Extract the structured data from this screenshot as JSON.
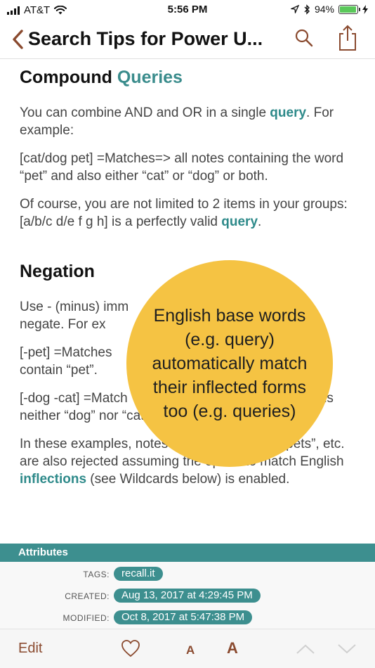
{
  "status_bar": {
    "carrier": "AT&T",
    "time": "5:56 PM",
    "battery": "94%",
    "battery_level": 0.94
  },
  "nav": {
    "title": "Search Tips for Power U..."
  },
  "content": {
    "section1": {
      "heading_plain": "Compound ",
      "heading_accent": "Queries",
      "p1_a": "You can combine AND and OR in a single ",
      "p1_link": "query",
      "p1_b": ". For example:",
      "p2": "[cat/dog pet]  =Matches=>  all notes containing the word “pet” and also either “cat” or “dog” or both.",
      "p3_a": "Of course, you are not limited to 2 items in your groups:  [a/b/c d/e f g h] is a perfectly valid ",
      "p3_link": "query",
      "p3_b": "."
    },
    "section2": {
      "heading": "Negation",
      "p1_a": "Use - (minus) imm",
      "p1_b": " wish to negate. For ex",
      "p2_a": "[-pet]  =Matches",
      "p2_b": "contain “pet”.",
      "p3_a": "[-dog  -cat]  =Match",
      "p3_b": "ontains neither “dog” nor “cat”.",
      "p4_a": "In these examples, notes containing “dogs”, “pets”, etc. are also rejected assuming the option to match English ",
      "p4_link": "inflections",
      "p4_b": " (see Wildcards below) is enabled."
    }
  },
  "tooltip": {
    "text": "English base words (e.g. query) automatically match their inflected forms too (e.g. queries)"
  },
  "attributes": {
    "header": "Attributes",
    "tags_label": "TAGS:",
    "tags_value": "recall.it",
    "created_label": "CREATED:",
    "created_value": "Aug 13, 2017 at 4:29:45 PM",
    "modified_label": "MODIFIED:",
    "modified_value": "Oct 8, 2017 at 5:47:38 PM"
  },
  "toolbar": {
    "edit_label": "Edit",
    "font_small": "A",
    "font_large": "A"
  },
  "colors": {
    "accent_teal": "#3d8f8f",
    "accent_brown": "#8a4a2f",
    "bubble_yellow": "#f5c343"
  },
  "icons": [
    "back-chevron-icon",
    "search-icon",
    "share-icon",
    "heart-icon",
    "chevron-up-icon",
    "chevron-down-icon",
    "wifi-icon",
    "location-icon",
    "bluetooth-icon",
    "battery-icon",
    "charging-icon"
  ]
}
